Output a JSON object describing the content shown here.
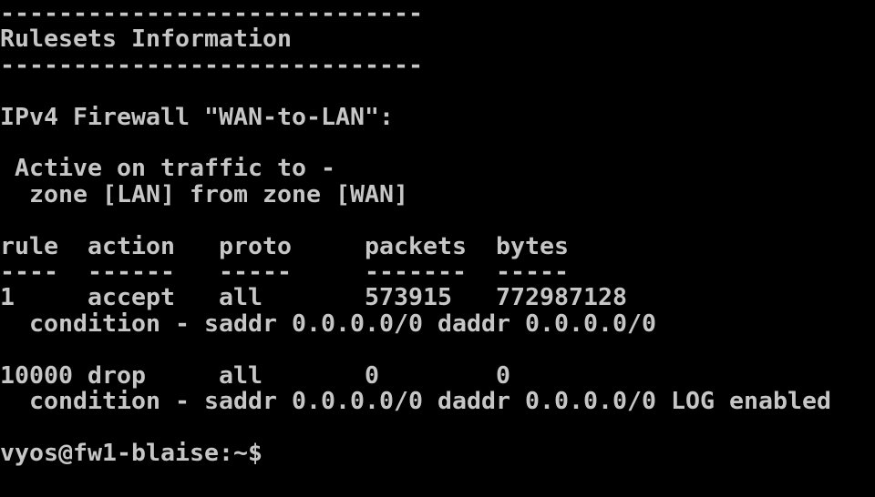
{
  "terminal": {
    "lines": [
      "-----------------------------",
      "Rulesets Information",
      "-----------------------------",
      "",
      "IPv4 Firewall \"WAN-to-LAN\":",
      "",
      " Active on traffic to -",
      "  zone [LAN] from zone [WAN]",
      "",
      "rule  action   proto     packets  bytes",
      "----  ------   -----     -------  -----",
      "1     accept   all       573915   772987128",
      "  condition - saddr 0.0.0.0/0 daddr 0.0.0.0/0",
      "",
      "10000 drop     all       0        0",
      "  condition - saddr 0.0.0.0/0 daddr 0.0.0.0/0 LOG enabled",
      "",
      "vyos@fw1-blaise:~$"
    ]
  },
  "colors": {
    "background": "#000000",
    "foreground": "#c6c6c6"
  }
}
